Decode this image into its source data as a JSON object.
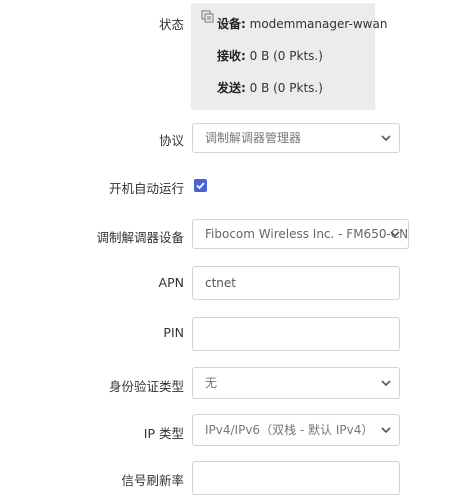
{
  "status": {
    "label": "状态",
    "device_key": "设备:",
    "device_value": " modemmanager-wwan",
    "rx_key": "接收:",
    "rx_value": " 0 B (0 Pkts.)",
    "tx_key": "发送:",
    "tx_value": " 0 B (0 Pkts.)"
  },
  "protocol": {
    "label": "协议",
    "value": "调制解调器管理器"
  },
  "autostart": {
    "label": "开机自动运行",
    "checked": true
  },
  "modem_device": {
    "label": "调制解调器设备",
    "value": "Fibocom Wireless Inc. - FM650-CN"
  },
  "apn": {
    "label": "APN",
    "value": "ctnet"
  },
  "pin": {
    "label": "PIN",
    "value": ""
  },
  "auth_type": {
    "label": "身份验证类型",
    "value": "无"
  },
  "ip_type": {
    "label": "IP 类型",
    "value": "IPv4/IPv6（双栈 - 默认 IPv4）"
  },
  "signal_refresh": {
    "label": "信号刷新率",
    "value": ""
  },
  "colors": {
    "checkbox": "#4a63d3",
    "status_bg": "#ececec"
  },
  "icons": {
    "status": "network-device-icon",
    "dropdown": "chevron-down-icon",
    "check": "check-icon"
  }
}
